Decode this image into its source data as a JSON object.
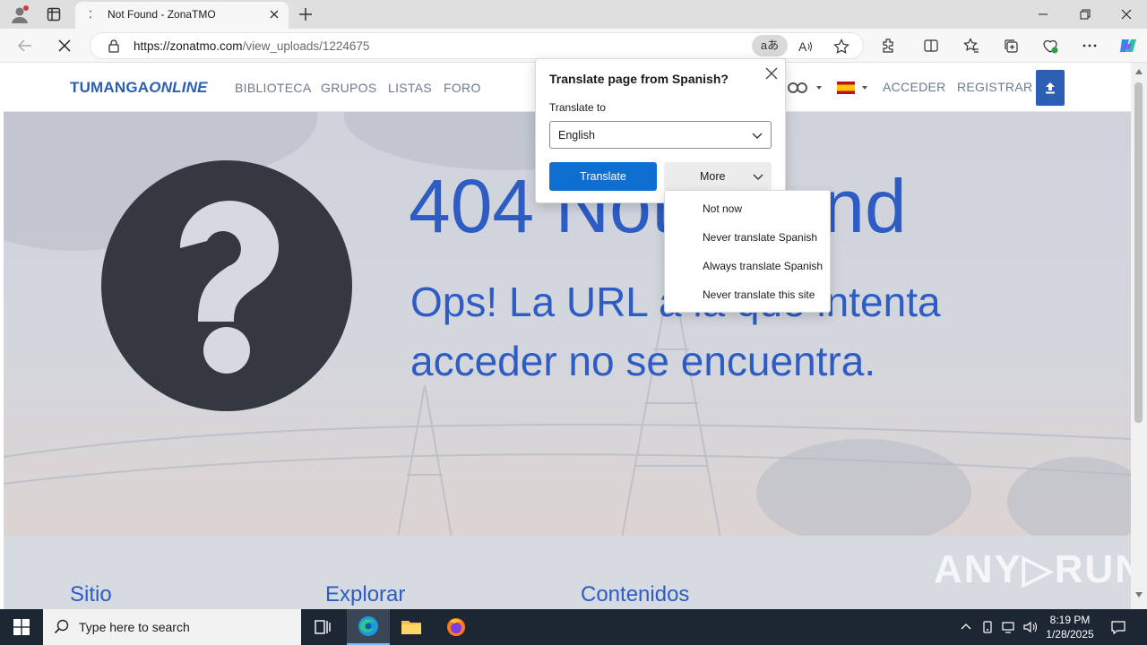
{
  "browser": {
    "tab_title": "Not Found - ZonaTMO",
    "url_host": "https://zonatmo.com",
    "url_path": "/view_uploads/1224675",
    "translate_pill": "aあ"
  },
  "site": {
    "logo_main": "TUMANGA",
    "logo_italic": "ONLINE",
    "nav": [
      "BIBLIOTECA",
      "GRUPOS",
      "LISTAS",
      "FORO"
    ],
    "login": "ACCEDER",
    "register": "REGISTRAR",
    "error_title": "404 Not Found",
    "error_sub": "Ops! La URL a la que intenta acceder no se encuentra.",
    "footer_headings": [
      "Sitio",
      "Explorar",
      "Contenidos"
    ],
    "watermark": "ANY▷RUN"
  },
  "translate_popup": {
    "title": "Translate page from Spanish?",
    "label": "Translate to",
    "selected_language": "English",
    "translate_button": "Translate",
    "more_button": "More",
    "menu_items": [
      "Not now",
      "Never translate Spanish",
      "Always translate Spanish",
      "Never translate this site"
    ]
  },
  "taskbar": {
    "search_placeholder": "Type here to search",
    "time": "8:19 PM",
    "date": "1/28/2025"
  },
  "colors": {
    "brand_blue": "#2b5fb4",
    "error_blue": "#2d5cc4",
    "translate_button": "#0f6fd1",
    "taskbar": "#1d2633"
  }
}
